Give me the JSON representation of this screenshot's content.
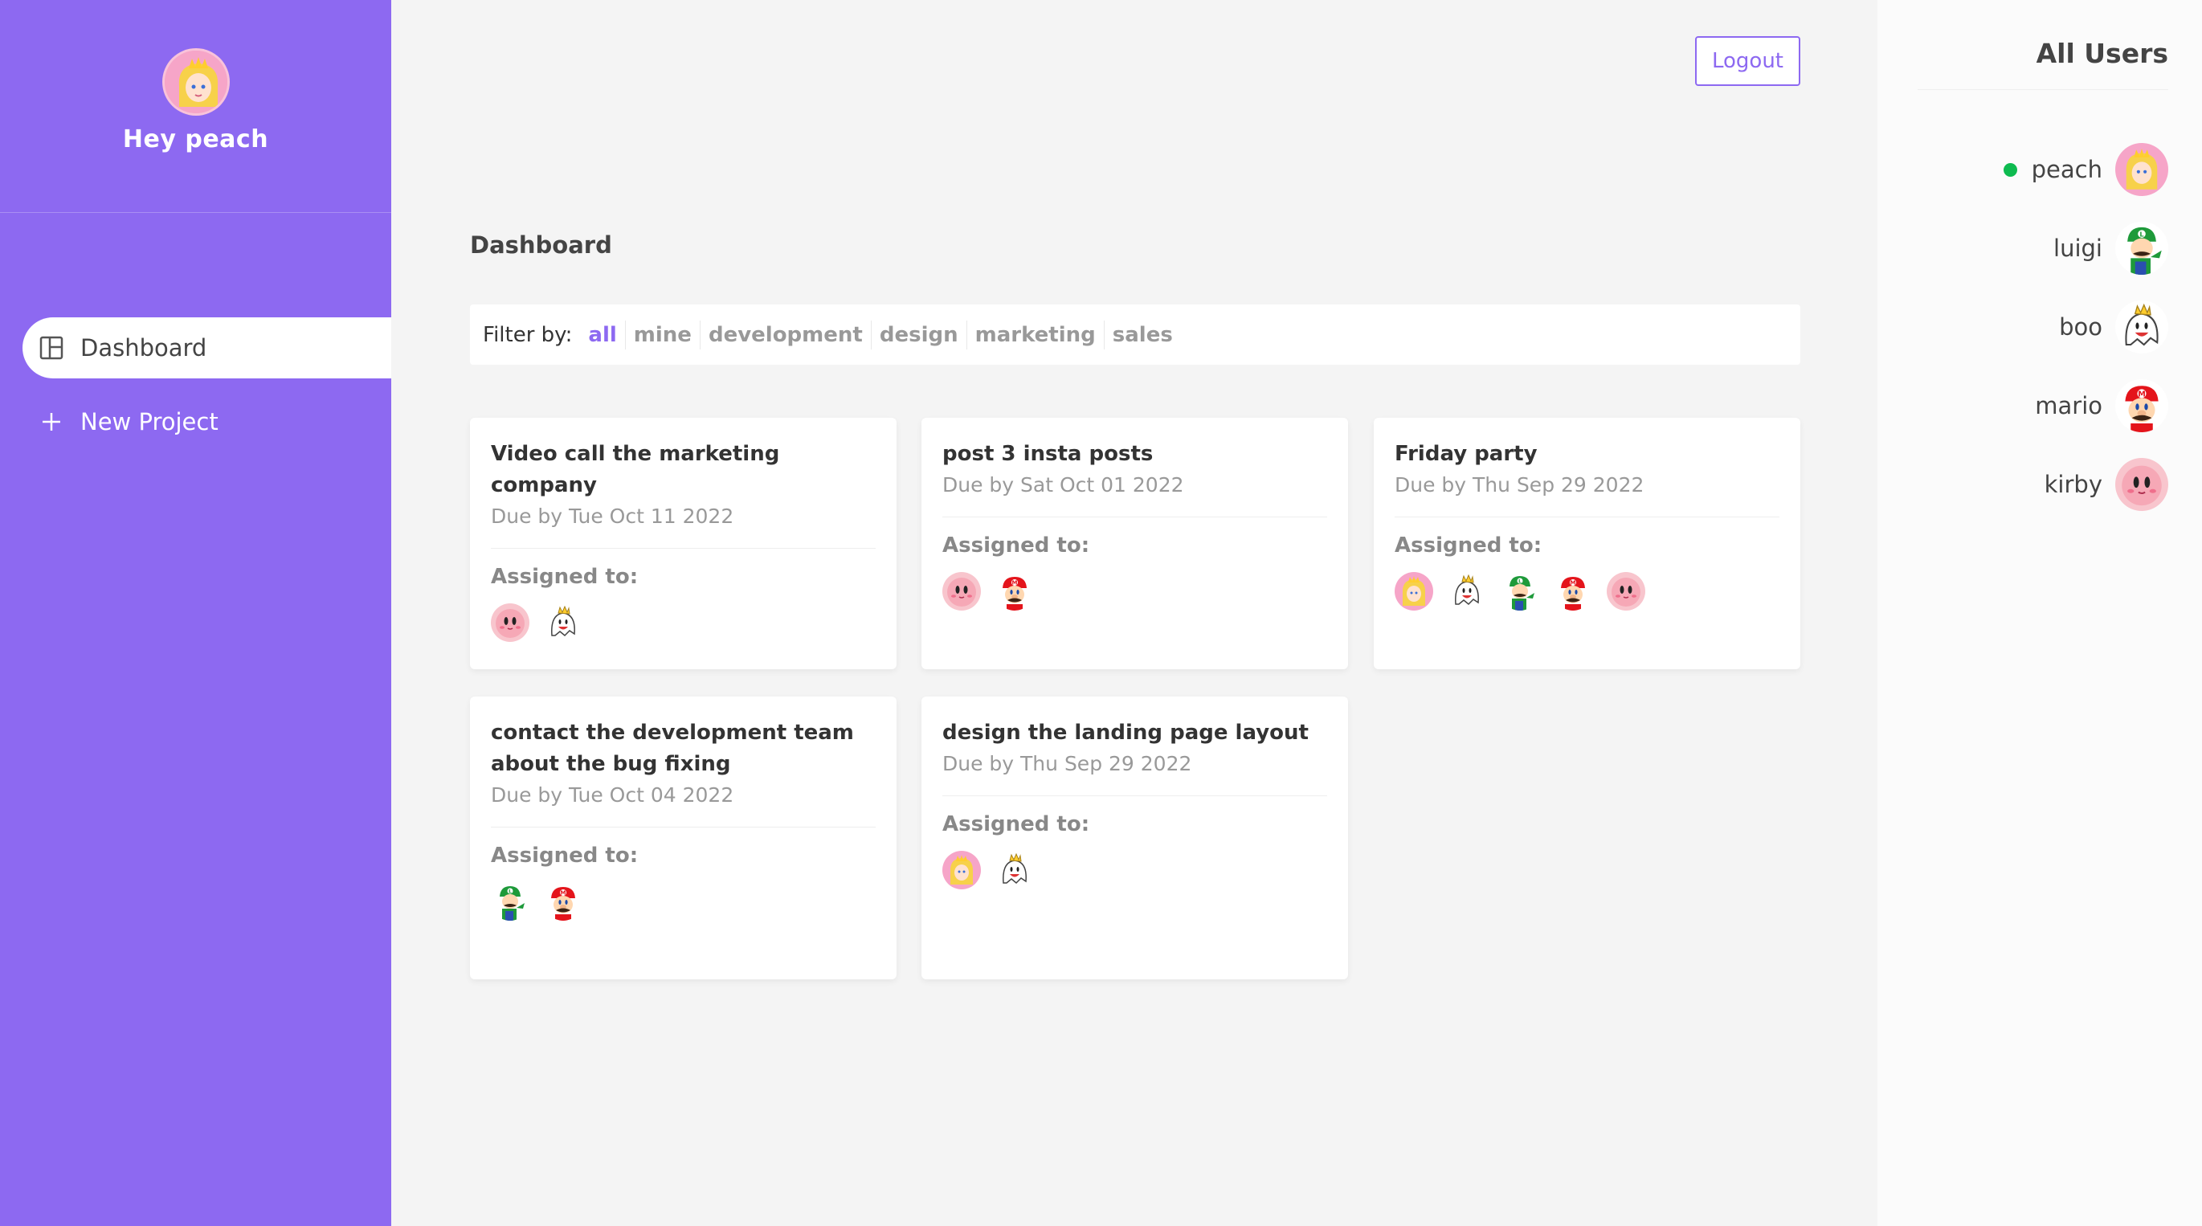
{
  "sidebar": {
    "greeting": "Hey peach",
    "nav": [
      {
        "label": "Dashboard",
        "icon": "dashboard-icon",
        "active": true
      },
      {
        "label": "New Project",
        "icon": "plus-icon",
        "active": false
      }
    ]
  },
  "header": {
    "logout_label": "Logout"
  },
  "main": {
    "title": "Dashboard",
    "filter": {
      "label": "Filter by:",
      "options": [
        "all",
        "mine",
        "development",
        "design",
        "marketing",
        "sales"
      ],
      "selected": "all"
    },
    "assigned_label": "Assigned to:",
    "projects": [
      {
        "title": "Video call the marketing company",
        "due": "Due by Tue Oct 11 2022",
        "assigned": [
          "kirby",
          "boo"
        ]
      },
      {
        "title": "post 3 insta posts",
        "due": "Due by Sat Oct 01 2022",
        "assigned": [
          "kirby",
          "mario"
        ]
      },
      {
        "title": "Friday party",
        "due": "Due by Thu Sep 29 2022",
        "assigned": [
          "peach",
          "boo",
          "luigi",
          "mario",
          "kirby"
        ]
      },
      {
        "title": "contact the development team about the bug fixing",
        "due": "Due by Tue Oct 04 2022",
        "assigned": [
          "luigi",
          "mario"
        ]
      },
      {
        "title": "design the landing page layout",
        "due": "Due by Thu Sep 29 2022",
        "assigned": [
          "peach",
          "boo"
        ]
      }
    ]
  },
  "users_panel": {
    "title": "All Users",
    "users": [
      {
        "name": "peach",
        "online": true
      },
      {
        "name": "luigi",
        "online": false
      },
      {
        "name": "boo",
        "online": false
      },
      {
        "name": "mario",
        "online": false
      },
      {
        "name": "kirby",
        "online": false
      }
    ]
  },
  "colors": {
    "accent": "#8d69f1",
    "online": "#0ebb50",
    "background": "#f4f4f4"
  }
}
